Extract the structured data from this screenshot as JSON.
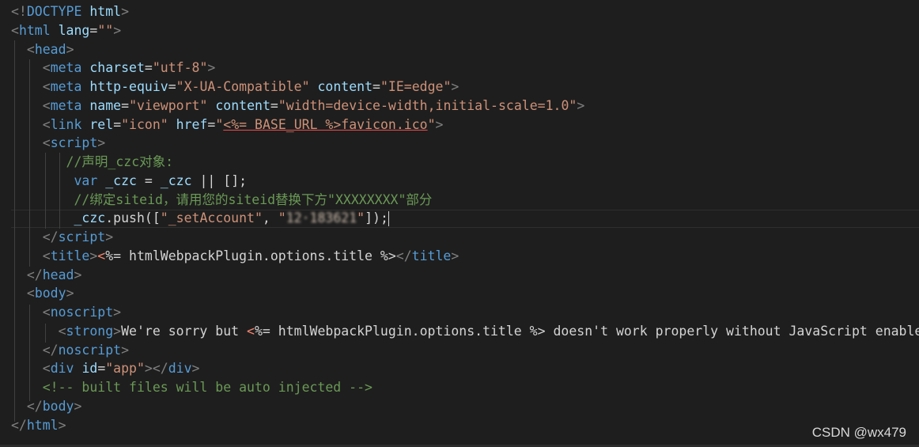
{
  "code_lines": [
    [
      {
        "t": "<!",
        "c": "punc"
      },
      {
        "t": "DOCTYPE",
        "c": "tag"
      },
      {
        "t": " html",
        "c": "attr"
      },
      {
        "t": ">",
        "c": "punc"
      }
    ],
    [
      {
        "t": "<",
        "c": "punc"
      },
      {
        "t": "html",
        "c": "tag"
      },
      {
        "t": " ",
        "c": "text"
      },
      {
        "t": "lang",
        "c": "attr"
      },
      {
        "t": "=",
        "c": "text"
      },
      {
        "t": "\"\"",
        "c": "str"
      },
      {
        "t": ">",
        "c": "punc"
      }
    ],
    [
      {
        "t": "  ",
        "c": "text"
      },
      {
        "t": "<",
        "c": "punc"
      },
      {
        "t": "head",
        "c": "tag"
      },
      {
        "t": ">",
        "c": "punc"
      }
    ],
    [
      {
        "t": "    ",
        "c": "text"
      },
      {
        "t": "<",
        "c": "punc"
      },
      {
        "t": "meta",
        "c": "tag"
      },
      {
        "t": " ",
        "c": "text"
      },
      {
        "t": "charset",
        "c": "attr"
      },
      {
        "t": "=",
        "c": "text"
      },
      {
        "t": "\"utf-8\"",
        "c": "str"
      },
      {
        "t": ">",
        "c": "punc"
      }
    ],
    [
      {
        "t": "    ",
        "c": "text"
      },
      {
        "t": "<",
        "c": "punc"
      },
      {
        "t": "meta",
        "c": "tag"
      },
      {
        "t": " ",
        "c": "text"
      },
      {
        "t": "http-equiv",
        "c": "attr"
      },
      {
        "t": "=",
        "c": "text"
      },
      {
        "t": "\"X-UA-Compatible\"",
        "c": "str"
      },
      {
        "t": " ",
        "c": "text"
      },
      {
        "t": "content",
        "c": "attr"
      },
      {
        "t": "=",
        "c": "text"
      },
      {
        "t": "\"IE=edge\"",
        "c": "str"
      },
      {
        "t": ">",
        "c": "punc"
      }
    ],
    [
      {
        "t": "    ",
        "c": "text"
      },
      {
        "t": "<",
        "c": "punc"
      },
      {
        "t": "meta",
        "c": "tag"
      },
      {
        "t": " ",
        "c": "text"
      },
      {
        "t": "name",
        "c": "attr"
      },
      {
        "t": "=",
        "c": "text"
      },
      {
        "t": "\"viewport\"",
        "c": "str"
      },
      {
        "t": " ",
        "c": "text"
      },
      {
        "t": "content",
        "c": "attr"
      },
      {
        "t": "=",
        "c": "text"
      },
      {
        "t": "\"width=device-width,initial-scale=1.0\"",
        "c": "str"
      },
      {
        "t": ">",
        "c": "punc"
      }
    ],
    [
      {
        "t": "    ",
        "c": "text"
      },
      {
        "t": "<",
        "c": "punc"
      },
      {
        "t": "link",
        "c": "tag"
      },
      {
        "t": " ",
        "c": "text"
      },
      {
        "t": "rel",
        "c": "attr"
      },
      {
        "t": "=",
        "c": "text"
      },
      {
        "t": "\"icon\"",
        "c": "str"
      },
      {
        "t": " ",
        "c": "text"
      },
      {
        "t": "href",
        "c": "attr"
      },
      {
        "t": "=",
        "c": "text"
      },
      {
        "t": "\"",
        "c": "str"
      },
      {
        "t": "<%= BASE_URL %>favicon.ico",
        "c": "str",
        "squiggle": true
      },
      {
        "t": "\"",
        "c": "str"
      },
      {
        "t": ">",
        "c": "punc"
      }
    ],
    [
      {
        "t": "    ",
        "c": "text"
      },
      {
        "t": "<",
        "c": "punc"
      },
      {
        "t": "script",
        "c": "tag"
      },
      {
        "t": ">",
        "c": "punc"
      }
    ],
    [
      {
        "t": "       ",
        "c": "text"
      },
      {
        "t": "//声明_czc对象:",
        "c": "comment"
      }
    ],
    [
      {
        "t": "        ",
        "c": "text"
      },
      {
        "t": "var",
        "c": "tag"
      },
      {
        "t": " ",
        "c": "text"
      },
      {
        "t": "_czc",
        "c": "js"
      },
      {
        "t": " = ",
        "c": "text"
      },
      {
        "t": "_czc",
        "c": "js"
      },
      {
        "t": " || [];",
        "c": "text"
      }
    ],
    [
      {
        "t": "        ",
        "c": "text"
      },
      {
        "t": "//绑定siteid，请用您的siteid替换下方\"XXXXXXXX\"部分",
        "c": "comment"
      }
    ],
    [
      {
        "t": "        ",
        "c": "text"
      },
      {
        "t": "_czc",
        "c": "js"
      },
      {
        "t": ".push([",
        "c": "text"
      },
      {
        "t": "\"_setAccount\"",
        "c": "str"
      },
      {
        "t": ", ",
        "c": "text"
      },
      {
        "t": "\"",
        "c": "str"
      },
      {
        "t": "12·183621",
        "c": "str",
        "blur": true
      },
      {
        "t": "\"",
        "c": "str"
      },
      {
        "t": "]);",
        "c": "text"
      },
      {
        "t": "",
        "c": "cursor"
      }
    ],
    [
      {
        "t": "    ",
        "c": "text"
      },
      {
        "t": "</",
        "c": "punc"
      },
      {
        "t": "script",
        "c": "tag"
      },
      {
        "t": ">",
        "c": "punc"
      }
    ],
    [
      {
        "t": "    ",
        "c": "text"
      },
      {
        "t": "<",
        "c": "punc"
      },
      {
        "t": "title",
        "c": "tag"
      },
      {
        "t": ">",
        "c": "punc"
      },
      {
        "t": "<",
        "c": "ejs"
      },
      {
        "t": "%= htmlWebpackPlugin.options.title %>",
        "c": "text"
      },
      {
        "t": "</",
        "c": "punc"
      },
      {
        "t": "title",
        "c": "tag"
      },
      {
        "t": ">",
        "c": "punc"
      }
    ],
    [
      {
        "t": "  ",
        "c": "text"
      },
      {
        "t": "</",
        "c": "punc"
      },
      {
        "t": "head",
        "c": "tag"
      },
      {
        "t": ">",
        "c": "punc"
      }
    ],
    [
      {
        "t": "  ",
        "c": "text"
      },
      {
        "t": "<",
        "c": "punc"
      },
      {
        "t": "body",
        "c": "tag"
      },
      {
        "t": ">",
        "c": "punc"
      }
    ],
    [
      {
        "t": "    ",
        "c": "text"
      },
      {
        "t": "<",
        "c": "punc"
      },
      {
        "t": "noscript",
        "c": "tag"
      },
      {
        "t": ">",
        "c": "punc"
      }
    ],
    [
      {
        "t": "      ",
        "c": "text"
      },
      {
        "t": "<",
        "c": "punc"
      },
      {
        "t": "strong",
        "c": "tag"
      },
      {
        "t": ">",
        "c": "punc"
      },
      {
        "t": "We're sorry but ",
        "c": "text"
      },
      {
        "t": "<",
        "c": "ejs"
      },
      {
        "t": "%= htmlWebpackPlugin.options.title %> doesn't work properly without JavaScript enabled. P",
        "c": "text"
      }
    ],
    [
      {
        "t": "    ",
        "c": "text"
      },
      {
        "t": "</",
        "c": "punc"
      },
      {
        "t": "noscript",
        "c": "tag"
      },
      {
        "t": ">",
        "c": "punc"
      }
    ],
    [
      {
        "t": "    ",
        "c": "text"
      },
      {
        "t": "<",
        "c": "punc"
      },
      {
        "t": "div",
        "c": "tag"
      },
      {
        "t": " ",
        "c": "text"
      },
      {
        "t": "id",
        "c": "attr"
      },
      {
        "t": "=",
        "c": "text"
      },
      {
        "t": "\"app\"",
        "c": "str"
      },
      {
        "t": "></",
        "c": "punc"
      },
      {
        "t": "div",
        "c": "tag"
      },
      {
        "t": ">",
        "c": "punc"
      }
    ],
    [
      {
        "t": "    ",
        "c": "text"
      },
      {
        "t": "<!-- built files will be auto injected -->",
        "c": "comment"
      }
    ],
    [
      {
        "t": "  ",
        "c": "text"
      },
      {
        "t": "</",
        "c": "punc"
      },
      {
        "t": "body",
        "c": "tag"
      },
      {
        "t": ">",
        "c": "punc"
      }
    ],
    [
      {
        "t": "</",
        "c": "punc"
      },
      {
        "t": "html",
        "c": "tag"
      },
      {
        "t": ">",
        "c": "punc"
      }
    ]
  ],
  "watermark": "CSDN @wx479",
  "colors": {
    "background": "#1e1e1e",
    "tag": "#569cd6",
    "attribute": "#9cdcfe",
    "string": "#ce9178",
    "comment": "#6a9955",
    "punctuation": "#808080",
    "error_squiggle": "#f14c4c"
  }
}
